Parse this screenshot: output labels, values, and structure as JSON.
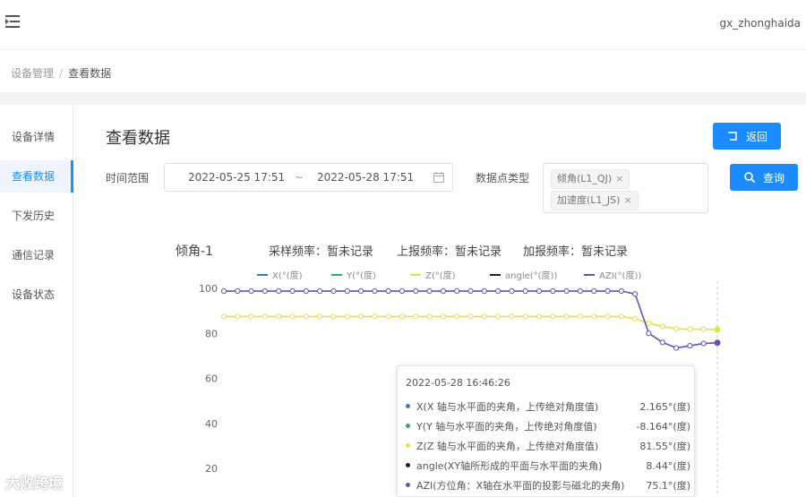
{
  "header": {
    "username": "gx_zhonghaida"
  },
  "breadcrumb": {
    "parent": "设备管理",
    "separator": "/",
    "current": "查看数据"
  },
  "sidebar": {
    "items": [
      {
        "label": "设备详情",
        "active": false
      },
      {
        "label": "查看数据",
        "active": true
      },
      {
        "label": "下发历史",
        "active": false
      },
      {
        "label": "通信记录",
        "active": false
      },
      {
        "label": "设备状态",
        "active": false
      }
    ]
  },
  "page": {
    "title": "查看数据",
    "back_label": "返回",
    "query_label": "查询"
  },
  "filters": {
    "time_range_label": "时间范围",
    "start": "2022-05-25 17:51",
    "separator": "~",
    "end": "2022-05-28 17:51",
    "point_type_label": "数据点类型",
    "tags": [
      "倾角(L1_QJ)",
      "加速度(L1_JS)"
    ],
    "tag_close": "×"
  },
  "chart_header": {
    "name": "倾角-1",
    "sample_rate": "采样频率：暂未记录",
    "report_rate": "上报频率：暂未记录",
    "acc_rate": "加报频率：暂未记录"
  },
  "tooltip": {
    "time": "2022-05-28 16:46:26",
    "rows": [
      {
        "name": "X(X 轴与水平面的夹角，上传绝对角度值)",
        "value": "2.165°(度)",
        "color": "#3b78c4"
      },
      {
        "name": "Y(Y 轴与水平面的夹角，上传绝对角度值)",
        "value": "-8.164°(度)",
        "color": "#33a673"
      },
      {
        "name": "Z(Z 轴与水平面的夹角，上传绝对角度值)",
        "value": "81.55°(度)",
        "color": "#e3e04a"
      },
      {
        "name": "angle(XY轴所形成的平面与水平面的夹角)",
        "value": "8.44°(度)",
        "color": "#222222"
      },
      {
        "name": "AZI(方位角：X轴在水平面的投影与磁北的夹角)",
        "value": "75.1°(度)",
        "color": "#6a4fb0"
      }
    ]
  },
  "watermark": "大败跨境",
  "chart_data": {
    "type": "line",
    "legend": [
      "X(°(度)",
      "Y(°(度)",
      "Z(°(度)",
      "angle(°(度))",
      "AZI(°(度))"
    ],
    "y_ticks": [
      100,
      80,
      60,
      40,
      20
    ],
    "ylim": [
      20,
      100
    ],
    "legend_position": "top",
    "grid": false,
    "series": [
      {
        "name": "Z(°(度)",
        "color": "#e3e04a",
        "values": [
          87.5,
          87.5,
          87.5,
          87.5,
          87.5,
          87.5,
          87.5,
          87.5,
          87.5,
          87.5,
          87.5,
          87.5,
          87.5,
          87.5,
          87.5,
          87.5,
          87.5,
          87.5,
          87.5,
          87.5,
          87.5,
          87.5,
          87.5,
          87.5,
          87.5,
          87.5,
          87.5,
          87.5,
          87.5,
          87.5,
          86.5,
          84.5,
          83,
          82,
          81.8,
          81.8,
          81.6
        ]
      },
      {
        "name": "AZI(°(度))",
        "color": "#6a4fb0",
        "values": [
          98.8,
          98.8,
          98.8,
          98.8,
          98.8,
          98.8,
          98.8,
          98.8,
          98.8,
          98.8,
          98.8,
          98.8,
          98.8,
          98.8,
          98.8,
          98.8,
          98.8,
          98.8,
          98.8,
          98.8,
          98.8,
          98.8,
          98.8,
          98.8,
          98.8,
          98.8,
          98.8,
          98.8,
          98.8,
          98.8,
          97.5,
          80,
          76,
          73.5,
          74.5,
          75.5,
          75.8
        ]
      }
    ]
  }
}
